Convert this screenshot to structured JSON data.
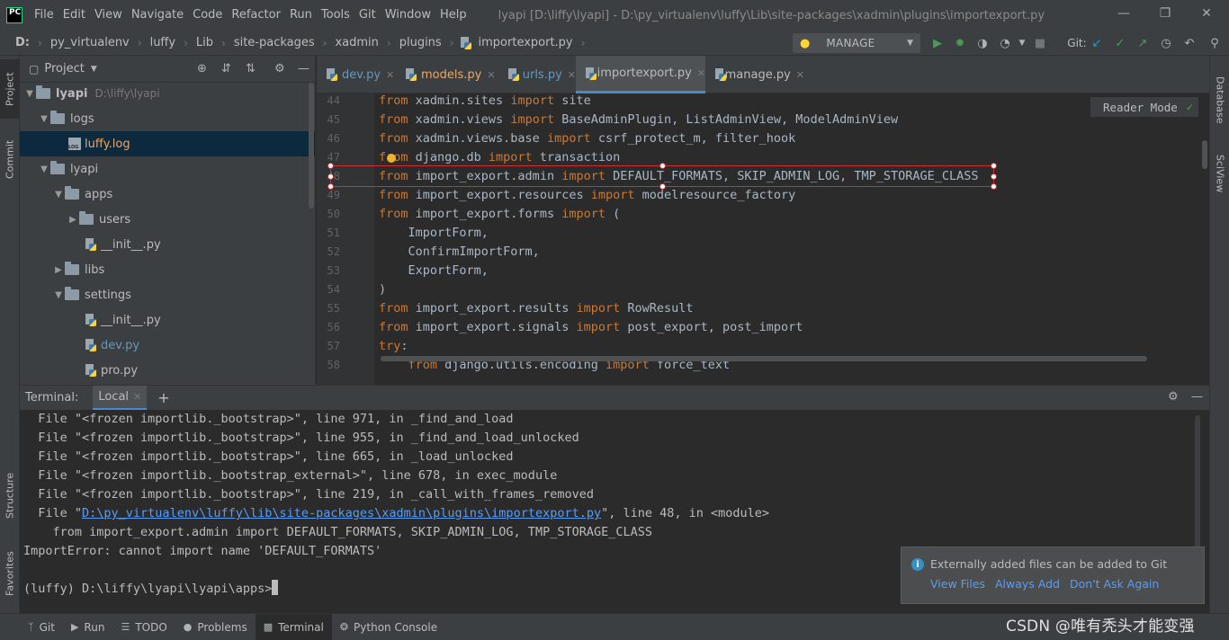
{
  "app": {
    "logo_text": "PC",
    "window_title": "lyapi [D:\\liffy\\lyapi] - D:\\py_virtualenv\\luffy\\Lib\\site-packages\\xadmin\\plugins\\importexport.py"
  },
  "menu": [
    "File",
    "Edit",
    "View",
    "Navigate",
    "Code",
    "Refactor",
    "Run",
    "Tools",
    "Git",
    "Window",
    "Help"
  ],
  "breadcrumb": [
    "D:",
    "py_virtualenv",
    "luffy",
    "Lib",
    "site-packages",
    "xadmin",
    "plugins",
    "importexport.py"
  ],
  "toolbar": {
    "run_config": "MANAGE",
    "git_label": "Git:"
  },
  "left_strip": {
    "project": "Project",
    "commit": "Commit",
    "structure": "Structure",
    "favorites": "Favorites"
  },
  "right_strip": {
    "database": "Database",
    "sciview": "SciView"
  },
  "project_panel": {
    "title": "Project",
    "tree": [
      {
        "label": "lyapi",
        "hint": "D:\\liffy\\lyapi"
      },
      {
        "label": "logs"
      },
      {
        "label": "luffy.log"
      },
      {
        "label": "lyapi"
      },
      {
        "label": "apps"
      },
      {
        "label": "users"
      },
      {
        "label": "__init__.py"
      },
      {
        "label": "libs"
      },
      {
        "label": "settings"
      },
      {
        "label": "__init__.py"
      },
      {
        "label": "dev.py"
      },
      {
        "label": "pro.py"
      }
    ]
  },
  "editor_tabs": [
    "dev.py",
    "models.py",
    "urls.py",
    "importexport.py",
    "manage.py"
  ],
  "editor": {
    "reader_mode": "Reader Mode",
    "line_numbers": [
      "44",
      "45",
      "46",
      "47",
      "48",
      "49",
      "50",
      "51",
      "52",
      "53",
      "54",
      "55",
      "56",
      "57",
      "58"
    ],
    "lines": [
      {
        "kw1": "from",
        "t1": " xadmin.sites ",
        "kw2": "import",
        "t2": " site"
      },
      {
        "kw1": "from",
        "t1": " xadmin.views ",
        "kw2": "import",
        "t2": " BaseAdminPlugin, ListAdminView, ModelAdminView"
      },
      {
        "kw1": "from",
        "t1": " xadmin.views.base ",
        "kw2": "import",
        "t2": " csrf_protect_m, filter_hook"
      },
      {
        "kw1": "from",
        "t1": " django.db ",
        "kw2": "import",
        "t2": " transaction"
      },
      {
        "kw1": "from",
        "t1": " import_export.admin ",
        "kw2": "import",
        "t2": " DEFAULT_FORMATS, SKIP_ADMIN_LOG, TMP_STORAGE_CLASS"
      },
      {
        "kw1": "from",
        "t1": " import_export.resources ",
        "kw2": "import",
        "t2": " modelresource_factory"
      },
      {
        "kw1": "from",
        "t1": " import_export.forms ",
        "kw2": "import",
        "t2": " ("
      },
      {
        "kw1": "",
        "t1": "    ImportForm,",
        "kw2": "",
        "t2": ""
      },
      {
        "kw1": "",
        "t1": "    ConfirmImportForm,",
        "kw2": "",
        "t2": ""
      },
      {
        "kw1": "",
        "t1": "    ExportForm,",
        "kw2": "",
        "t2": ""
      },
      {
        "kw1": "",
        "t1": ")",
        "kw2": "",
        "t2": ""
      },
      {
        "kw1": "from",
        "t1": " import_export.results ",
        "kw2": "import",
        "t2": " RowResult"
      },
      {
        "kw1": "from",
        "t1": " import_export.signals ",
        "kw2": "import",
        "t2": " post_export, post_import"
      },
      {
        "kw1": "try",
        "t1": ":",
        "kw2": "",
        "t2": ""
      },
      {
        "kw1": "    from",
        "t1": " django.utils.encoding ",
        "kw2": "import",
        "t2": " force_text"
      }
    ]
  },
  "terminal": {
    "title": "Terminal:",
    "tab": "Local",
    "lines": [
      "  File \"<frozen importlib._bootstrap>\", line 971, in _find_and_load",
      "  File \"<frozen importlib._bootstrap>\", line 955, in _find_and_load_unlocked",
      "  File \"<frozen importlib._bootstrap>\", line 665, in _load_unlocked",
      "  File \"<frozen importlib._bootstrap_external>\", line 678, in exec_module",
      "  File \"<frozen importlib._bootstrap>\", line 219, in _call_with_frames_removed"
    ],
    "file_line_prefix": "  File \"",
    "file_line_link": "D:\\py_virtualenv\\luffy\\lib\\site-packages\\xadmin\\plugins\\importexport.py",
    "file_line_suffix": "\", line 48, in <module>",
    "source_line": "    from import_export.admin import DEFAULT_FORMATS, SKIP_ADMIN_LOG, TMP_STORAGE_CLASS",
    "error_line": "ImportError: cannot import name 'DEFAULT_FORMATS'",
    "prompt": "(luffy) D:\\liffy\\lyapi\\lyapi\\apps>"
  },
  "notification": {
    "message": "Externally added files can be added to Git",
    "actions": [
      "View Files",
      "Always Add",
      "Don't Ask Again"
    ]
  },
  "statusbar": [
    "Git",
    "Run",
    "TODO",
    "Problems",
    "Terminal",
    "Python Console"
  ],
  "watermark": "CSDN @唯有秃头才能变强",
  "colors": {
    "keyword": "#cc7832",
    "link": "#589df6",
    "highlight_box": "#d23030",
    "accent": "#4a88c7"
  }
}
